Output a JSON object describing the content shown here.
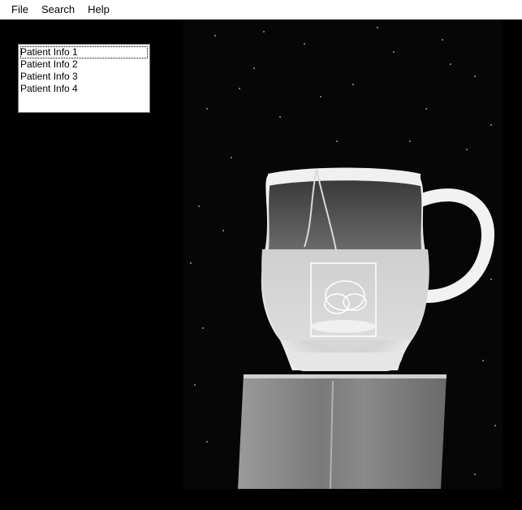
{
  "menu": {
    "items": [
      {
        "label": "File"
      },
      {
        "label": "Search"
      },
      {
        "label": "Help"
      }
    ]
  },
  "patient_list": {
    "items": [
      {
        "label": "Patient Info 1",
        "focused": true
      },
      {
        "label": "Patient Info 2",
        "focused": false
      },
      {
        "label": "Patient Info 3",
        "focused": false
      },
      {
        "label": "Patient Info 4",
        "focused": false
      }
    ]
  },
  "viewer": {
    "subject": "x-ray image of a mug on a block",
    "background_color": "#060606",
    "foreground_color": "#f2f2f2"
  }
}
